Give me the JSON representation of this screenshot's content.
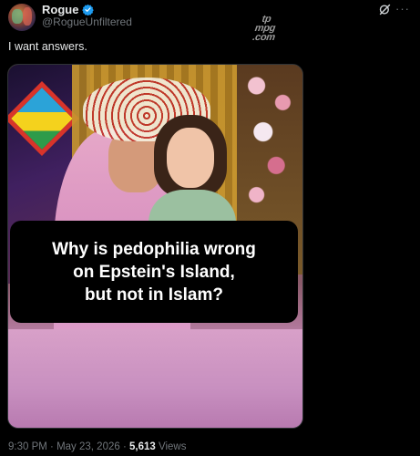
{
  "tweet": {
    "author_name": "Rogue",
    "author_handle": "@RogueUnfiltered",
    "text": "I want answers.",
    "watermark": [
      "tp",
      "mpg",
      ".com"
    ],
    "media_caption": "Why is pedophilia wrong\non Epstein's Island,\nbut not in Islam?",
    "time": "9:30 PM",
    "date": "May 23, 2026",
    "views_count": "5,613",
    "views_label": "Views",
    "separator": "·"
  },
  "icons": {
    "verified": "verified-badge-icon",
    "grok": "grok-icon",
    "more": "more-options-icon"
  },
  "colors": {
    "background": "#000000",
    "text_primary": "#e7e9ea",
    "text_secondary": "#71767b",
    "verified_blue": "#1d9bf0"
  }
}
